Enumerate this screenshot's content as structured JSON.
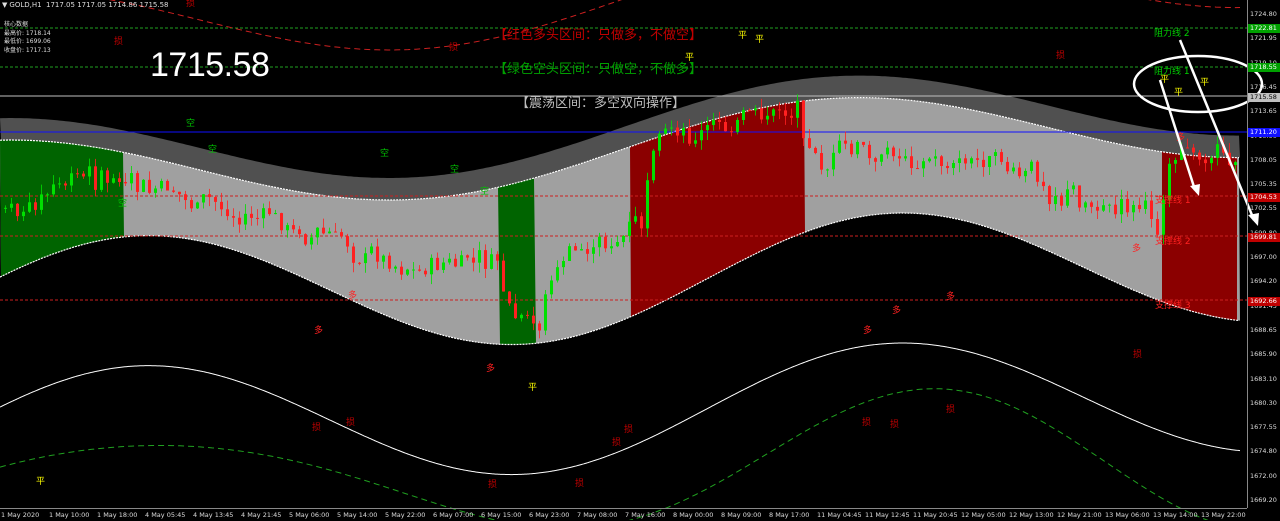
{
  "header": {
    "symbol": "GOLD,H1",
    "ohlc": "1717.05 1717.05 1714.86 1715.58"
  },
  "info_panel": {
    "lines": [
      "核心数据",
      "最高价: 1718.14",
      "最低价: 1699.06",
      "收盘价: 1717.13"
    ]
  },
  "big_price": "1715.58",
  "legend": {
    "red_zone": "【红色多头区间：只做多，不做空】",
    "green_zone": "【绿色空头区间：只做空，不做多】",
    "range_zone": "【震荡区间：多空双向操作】"
  },
  "colors": {
    "background": "#000000",
    "bull_candle": "#00e000",
    "bear_candle": "#ff2020",
    "bull_zone": "#8b0000",
    "bear_zone": "#006400",
    "range_zone": "#a0a0a0",
    "blue_line": "#1010ff",
    "dashed_red": "#cc2020",
    "dashed_green": "#20a020"
  },
  "price_axis": {
    "ticks": [
      "1724.80",
      "1721.95",
      "1719.10",
      "1716.45",
      "1713.65",
      "1710.90",
      "1708.05",
      "1705.35",
      "1702.55",
      "1699.80",
      "1697.00",
      "1694.20",
      "1691.45",
      "1688.65",
      "1685.90",
      "1683.10",
      "1680.30",
      "1677.55",
      "1674.80",
      "1672.00",
      "1669.20"
    ],
    "labels": [
      {
        "text": "1722.81",
        "color": "#00a000"
      },
      {
        "text": "1718.55",
        "color": "#00a000"
      },
      {
        "text": "1715.58",
        "color": "#c0c0c0"
      },
      {
        "text": "1711.20",
        "color": "#1010ff"
      },
      {
        "text": "1704.53",
        "color": "#c00000"
      },
      {
        "text": "1699.81",
        "color": "#c00000"
      },
      {
        "text": "1692.66",
        "color": "#c00000"
      }
    ]
  },
  "time_axis": {
    "ticks": [
      "1 May 2020",
      "1 May 10:00",
      "1 May 18:00",
      "4 May 05:45",
      "4 May 13:45",
      "4 May 21:45",
      "5 May 06:00",
      "5 May 14:00",
      "5 May 22:00",
      "6 May 07:00",
      "6 May 15:00",
      "6 May 23:00",
      "7 May 08:00",
      "7 May 16:00",
      "8 May 00:00",
      "8 May 09:00",
      "8 May 17:00",
      "11 May 04:45",
      "11 May 12:45",
      "11 May 20:45",
      "12 May 05:00",
      "12 May 13:00",
      "12 May 21:00",
      "13 May 06:00",
      "13 May 14:00",
      "13 May 22:00"
    ]
  },
  "annotations": {
    "kong": "空",
    "duo": "多",
    "ping": "平",
    "sun": "损",
    "resist1": "阻力线 1",
    "resist2": "阻力线 2",
    "support1": "支撑线 1",
    "support2": "支撑线 2",
    "support3": "支撑线 3"
  },
  "chart_data": {
    "type": "candlestick",
    "ylim": [
      1669.2,
      1726
    ],
    "levels": [
      {
        "name": "阻力线 2",
        "value": 1722.81
      },
      {
        "name": "阻力线 1",
        "value": 1718.55
      },
      {
        "name": "current",
        "value": 1715.58
      },
      {
        "name": "blue",
        "value": 1711.2
      },
      {
        "name": "支撑线 1",
        "value": 1704.53
      },
      {
        "name": "支撑线 2",
        "value": 1699.81
      },
      {
        "name": "支撑线 3",
        "value": 1692.66
      }
    ]
  }
}
